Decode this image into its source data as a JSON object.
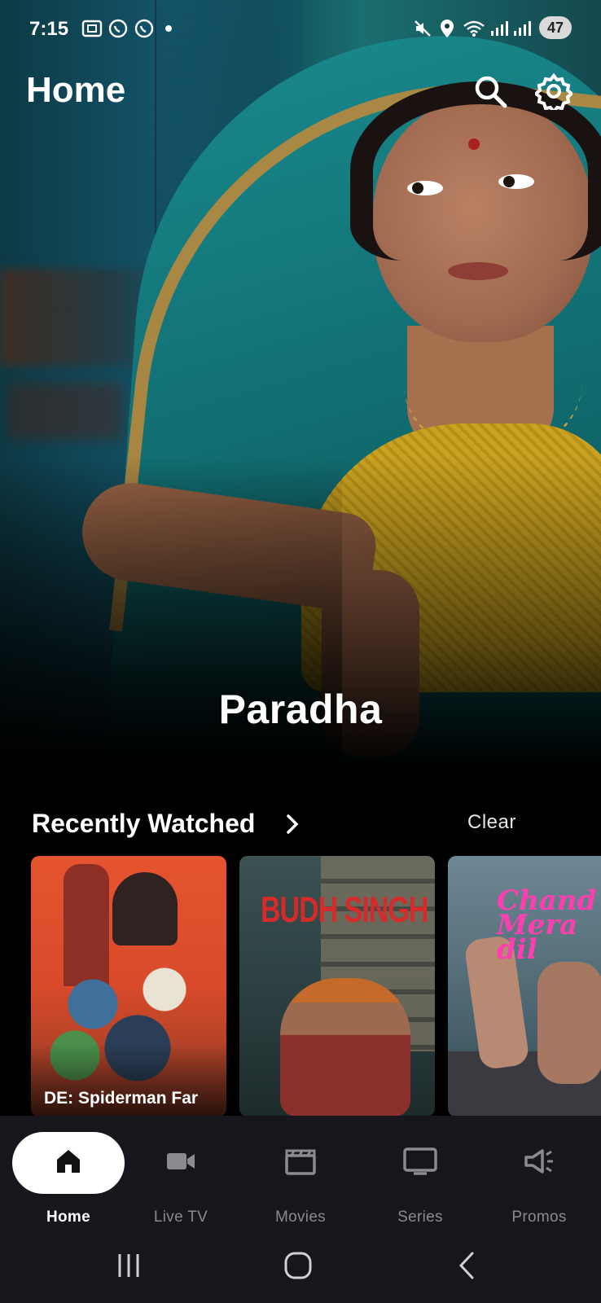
{
  "status_bar": {
    "time": "7:15",
    "battery": "47",
    "icons": [
      "screenshot-icon",
      "whatsapp-icon",
      "whatsapp-icon",
      "notification-dot-icon",
      "mute-icon",
      "location-icon",
      "wifi-icon",
      "signal-icon",
      "signal-icon"
    ]
  },
  "header": {
    "title": "Home",
    "search_icon": "search-icon",
    "settings_icon": "gear-icon"
  },
  "hero": {
    "title": "Paradha"
  },
  "recently_watched": {
    "title": "Recently Watched",
    "clear_label": "Clear",
    "items": [
      {
        "label": "DE: Spiderman Far",
        "poster_text": ""
      },
      {
        "label": "",
        "poster_text": "BUDH SINGH"
      },
      {
        "label": "",
        "poster_text": "Chand Mera dil"
      }
    ]
  },
  "bottom_nav": {
    "items": [
      {
        "label": "Home",
        "icon": "home-icon",
        "active": true
      },
      {
        "label": "Live TV",
        "icon": "video-camera-icon",
        "active": false
      },
      {
        "label": "Movies",
        "icon": "clapperboard-icon",
        "active": false
      },
      {
        "label": "Series",
        "icon": "tv-icon",
        "active": false
      },
      {
        "label": "Promos",
        "icon": "megaphone-icon",
        "active": false
      }
    ]
  },
  "colors": {
    "background": "#000000",
    "nav_background": "#17161d",
    "active_pill": "#ffffff",
    "inactive_label": "#8b8a91"
  }
}
